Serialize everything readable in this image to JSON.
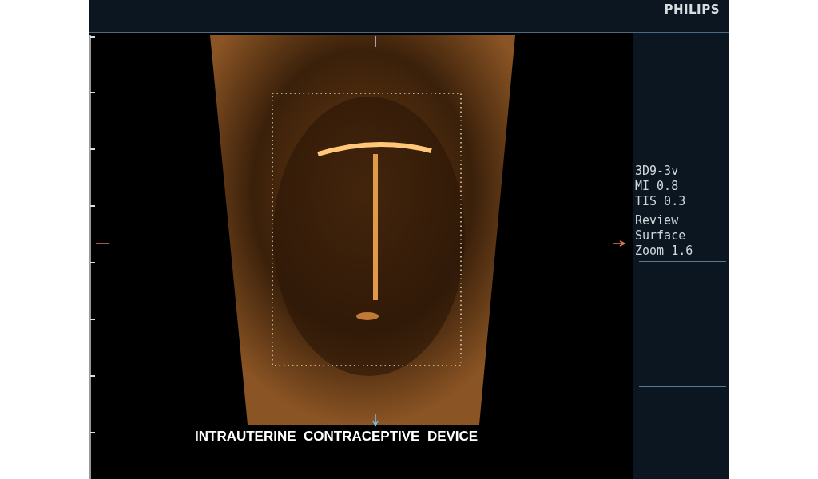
{
  "header": {
    "brand": "PHILIPS"
  },
  "image": {
    "caption": "INTRAUTERINE  CONTRACEPTIVE  DEVICE"
  },
  "side_panel": {
    "groups": [
      [
        "3D9-3v",
        "MI 0.8",
        "TIS 0.3"
      ],
      [
        "Review",
        "Surface",
        "Zoom 1.6"
      ]
    ]
  }
}
